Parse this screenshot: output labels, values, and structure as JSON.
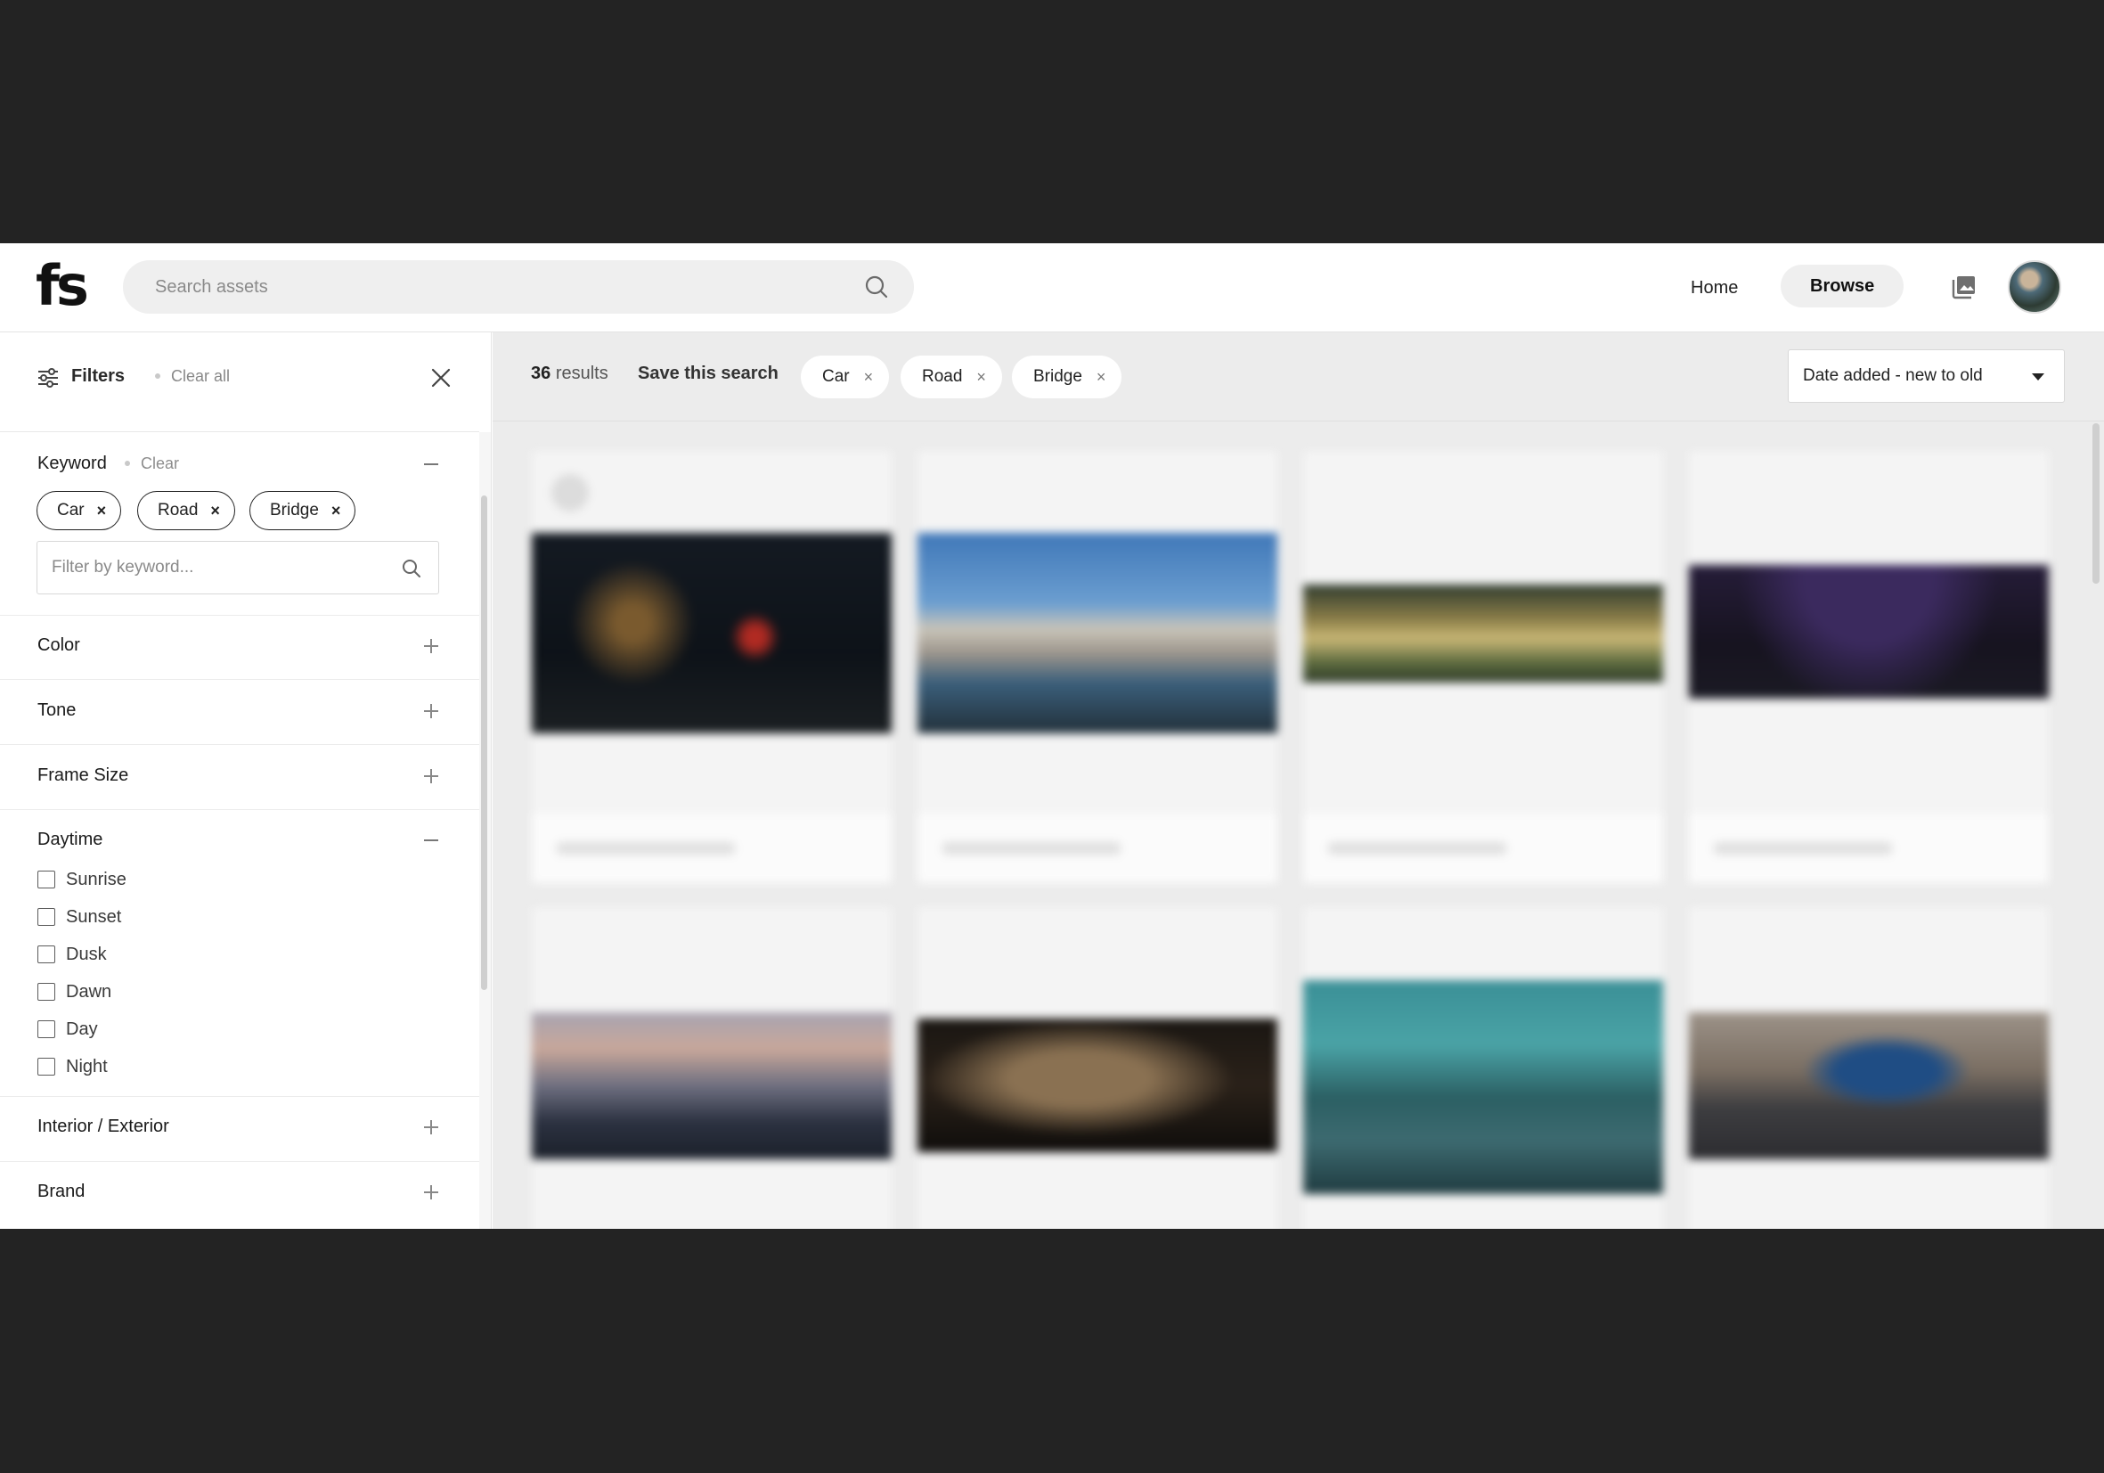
{
  "header": {
    "logo": "fs",
    "search_placeholder": "Search assets",
    "nav": {
      "home": "Home",
      "browse": "Browse"
    }
  },
  "sidebar": {
    "title": "Filters",
    "clear_all": "Clear all",
    "keyword": {
      "title": "Keyword",
      "clear": "Clear",
      "chips": [
        "Car",
        "Road",
        "Bridge"
      ],
      "filter_placeholder": "Filter by keyword..."
    },
    "sections": [
      "Color",
      "Tone",
      "Frame Size"
    ],
    "daytime": {
      "title": "Daytime",
      "options": [
        "Sunrise",
        "Sunset",
        "Dusk",
        "Dawn",
        "Day",
        "Night"
      ]
    },
    "sections_after": [
      "Interior / Exterior",
      "Brand"
    ]
  },
  "main": {
    "results_count": "36",
    "results_label": "results",
    "save_search": "Save this search",
    "tags": [
      "Car",
      "Road",
      "Bridge"
    ],
    "sort": "Date added - new to old"
  }
}
